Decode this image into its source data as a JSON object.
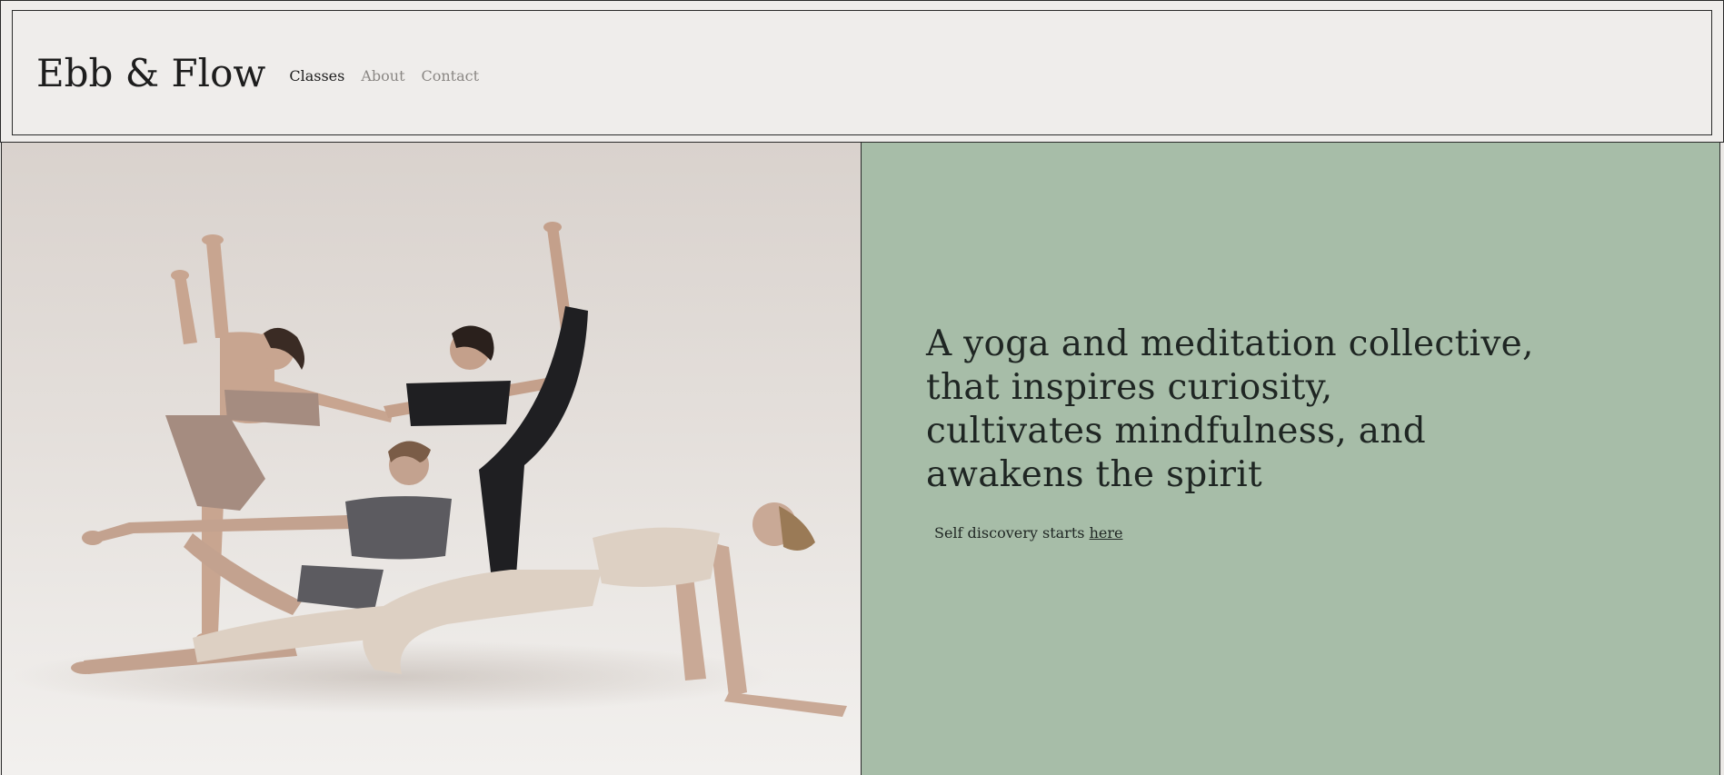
{
  "header": {
    "logo": "Ebb & Flow",
    "nav": [
      {
        "label": "Classes"
      },
      {
        "label": "About"
      },
      {
        "label": "Contact"
      }
    ]
  },
  "hero": {
    "headline_lines": [
      "A yoga and meditation collective,",
      "that inspires curiosity,",
      "cultivates mindfulness, and",
      "awakens the spirit"
    ],
    "cta_text": "Self discovery starts",
    "cta_link": "here"
  },
  "colors": {
    "header_bg": "#efedeb",
    "hero_right_bg": "#a7bda8",
    "text_dark": "#1d1d1d",
    "nav_muted": "#8a8784"
  }
}
